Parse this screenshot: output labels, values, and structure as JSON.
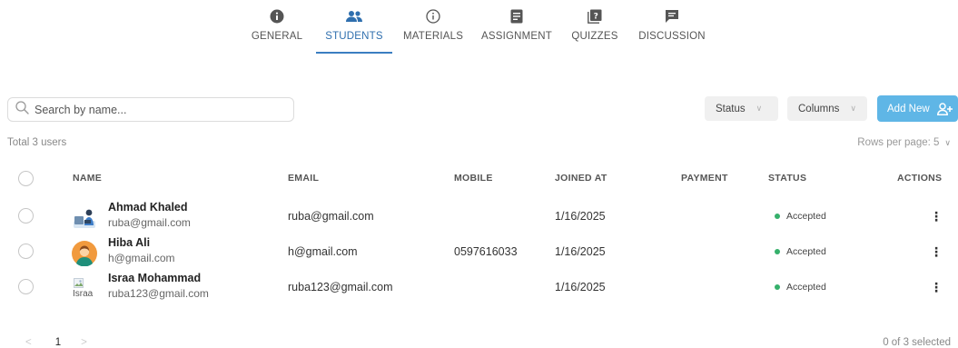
{
  "tabs": [
    {
      "label": "GENERAL",
      "icon": "info-filled-icon",
      "active": false
    },
    {
      "label": "STUDENTS",
      "icon": "users-icon",
      "active": true
    },
    {
      "label": "MATERIALS",
      "icon": "info-outline-icon",
      "active": false
    },
    {
      "label": "ASSIGNMENT",
      "icon": "document-icon",
      "active": false
    },
    {
      "label": "QUIZZES",
      "icon": "quiz-icon",
      "active": false
    },
    {
      "label": "DISCUSSION",
      "icon": "chat-icon",
      "active": false
    }
  ],
  "toolbar": {
    "search_placeholder": "Search by name...",
    "status_label": "Status",
    "columns_label": "Columns",
    "add_label": "Add New"
  },
  "summary": {
    "total": "Total 3 users",
    "rows_per_page": "Rows per page: 5"
  },
  "table": {
    "headers": {
      "name": "NAME",
      "email": "EMAIL",
      "mobile": "MOBILE",
      "joined": "JOINED AT",
      "payment": "PAYMENT",
      "status": "STATUS",
      "actions": "ACTIONS"
    },
    "rows": [
      {
        "name": "Ahmad Khaled",
        "sub_email": "ruba@gmail.com",
        "email": "ruba@gmail.com",
        "mobile": "",
        "joined": "1/16/2025",
        "payment": "",
        "status": "Accepted",
        "avatar": "illustration-avatar"
      },
      {
        "name": "Hiba Ali",
        "sub_email": "h@gmail.com",
        "email": "h@gmail.com",
        "mobile": "0597616033",
        "joined": "1/16/2025",
        "payment": "",
        "status": "Accepted",
        "avatar": "person-avatar"
      },
      {
        "name": "Israa Mohammad",
        "sub_email": "ruba123@gmail.com",
        "email": "ruba123@gmail.com",
        "mobile": "",
        "joined": "1/16/2025",
        "payment": "",
        "status": "Accepted",
        "avatar": "broken-image-avatar",
        "avatar_alt": "Israa"
      }
    ]
  },
  "footer": {
    "page": "1",
    "prev": "<",
    "next": ">",
    "selected": "0 of 3 selected"
  },
  "colors": {
    "accent": "#3b7ec1",
    "add_button": "#5fb6e6",
    "status_accepted": "#35b06b"
  }
}
